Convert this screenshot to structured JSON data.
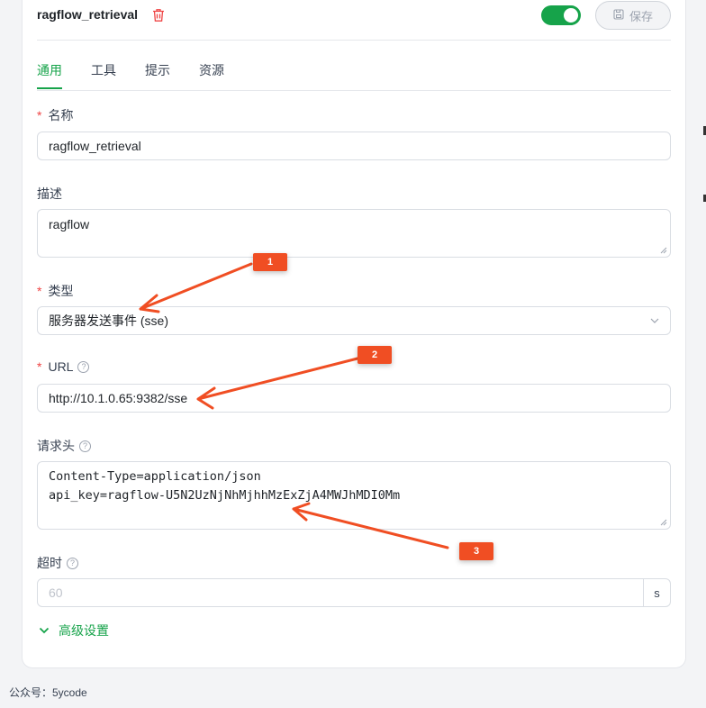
{
  "header": {
    "tool_name": "ragflow_retrieval",
    "enabled": true,
    "save_label": "保存"
  },
  "tabs": [
    {
      "label": "通用",
      "active": true
    },
    {
      "label": "工具",
      "active": false
    },
    {
      "label": "提示",
      "active": false
    },
    {
      "label": "资源",
      "active": false
    }
  ],
  "form": {
    "required_mark": "*",
    "name_label": "名称",
    "name_value": "ragflow_retrieval",
    "desc_label": "描述",
    "desc_value": "ragflow",
    "type_label": "类型",
    "type_value": "服务器发送事件 (sse)",
    "url_label": "URL",
    "url_value": "http://10.1.0.65:9382/sse",
    "headers_label": "请求头",
    "headers_value": "Content-Type=application/json\napi_key=ragflow-U5N2UzNjNhMjhhMzExZjA4MWJhMDI0Mm",
    "timeout_label": "超时",
    "timeout_placeholder": "60",
    "timeout_unit": "s",
    "advanced_label": "高级设置"
  },
  "annotations": [
    {
      "label": "1"
    },
    {
      "label": "2"
    },
    {
      "label": "3"
    }
  ],
  "footer": {
    "note": "公众号：5ycode"
  },
  "colors": {
    "accent": "#16a34a",
    "required": "#ef4444",
    "annotation": "#f04e23",
    "trash": "#ef4444"
  }
}
